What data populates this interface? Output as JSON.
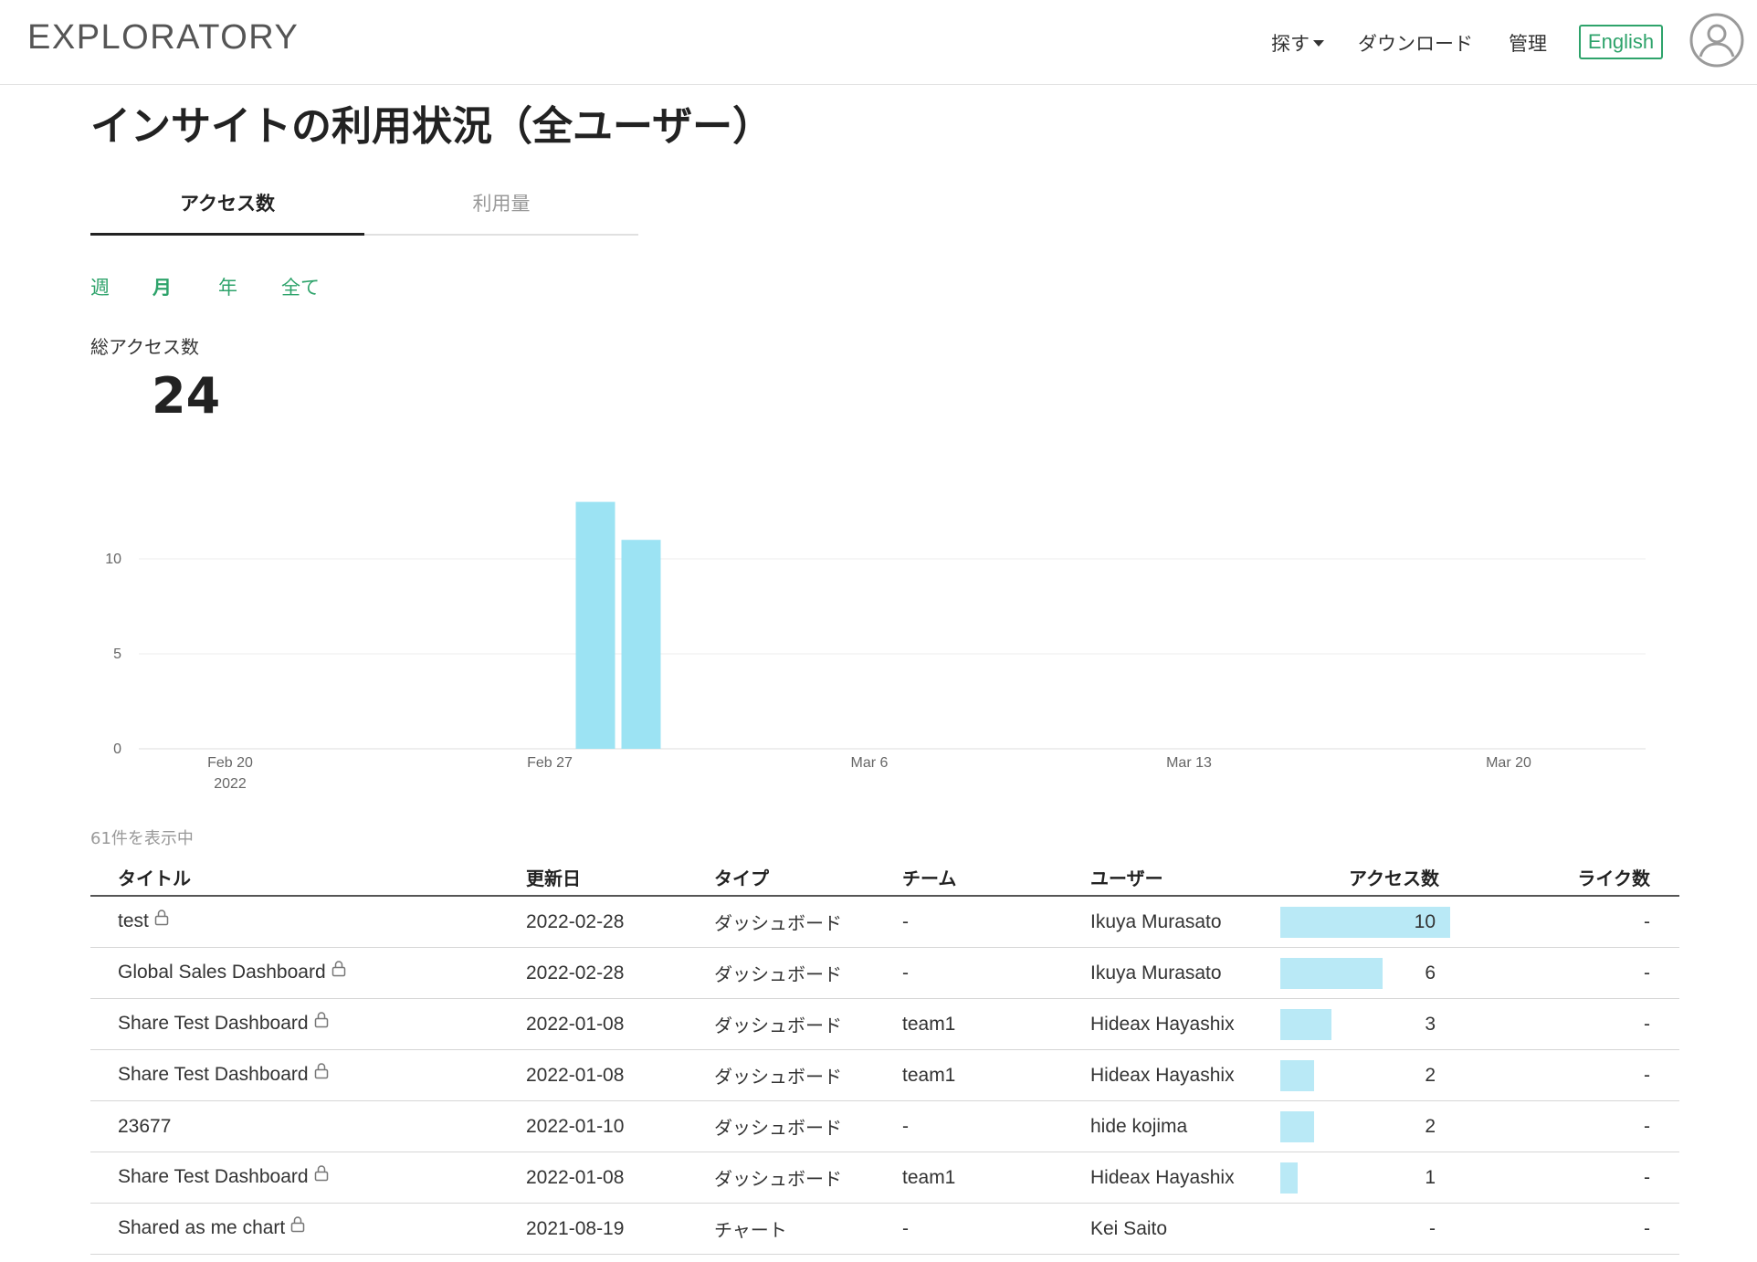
{
  "header": {
    "logo": "EXPLORATORY",
    "nav": [
      {
        "label": "探す",
        "has_dropdown": true
      },
      {
        "label": "ダウンロード"
      },
      {
        "label": "管理"
      }
    ],
    "lang_button": "English"
  },
  "page_title": "インサイトの利用状況（全ユーザー）",
  "tabs": [
    {
      "label": "アクセス数",
      "active": true
    },
    {
      "label": "利用量",
      "active": false
    }
  ],
  "periods": [
    {
      "label": "週",
      "selected": false
    },
    {
      "label": "月",
      "selected": true
    },
    {
      "label": "年",
      "selected": false
    },
    {
      "label": "全て",
      "selected": false
    }
  ],
  "total": {
    "label": "総アクセス数",
    "value": "24"
  },
  "chart_data": {
    "type": "bar",
    "x_type": "date",
    "x": [
      "2022-02-28",
      "2022-03-01"
    ],
    "values": [
      13,
      11
    ],
    "xlim": [
      "2022-02-18",
      "2022-03-23"
    ],
    "ylim": [
      0,
      14
    ],
    "yticks": [
      0,
      5,
      10
    ],
    "xticks": [
      {
        "date": "2022-02-20",
        "label": "Feb 20",
        "sublabel": "2022"
      },
      {
        "date": "2022-02-27",
        "label": "Feb 27"
      },
      {
        "date": "2022-03-06",
        "label": "Mar 6"
      },
      {
        "date": "2022-03-13",
        "label": "Mar 13"
      },
      {
        "date": "2022-03-20",
        "label": "Mar 20"
      }
    ],
    "grid": true,
    "color": "#9ce3f3"
  },
  "table": {
    "count_text": "61件を表示中",
    "columns": [
      "タイトル",
      "更新日",
      "タイプ",
      "チーム",
      "ユーザー",
      "アクセス数",
      "ライク数"
    ],
    "max_access": 10,
    "rows": [
      {
        "title": "test",
        "locked": true,
        "updated": "2022-02-28",
        "type": "ダッシュボード",
        "team": "-",
        "user": "Ikuya Murasato",
        "access": 10,
        "access_label": "10",
        "likes": "-"
      },
      {
        "title": "Global Sales Dashboard",
        "locked": true,
        "updated": "2022-02-28",
        "type": "ダッシュボード",
        "team": "-",
        "user": "Ikuya Murasato",
        "access": 6,
        "access_label": "6",
        "likes": "-"
      },
      {
        "title": "Share Test Dashboard",
        "locked": true,
        "updated": "2022-01-08",
        "type": "ダッシュボード",
        "team": "team1",
        "user": "Hideax Hayashix",
        "access": 3,
        "access_label": "3",
        "likes": "-"
      },
      {
        "title": "Share Test Dashboard",
        "locked": true,
        "updated": "2022-01-08",
        "type": "ダッシュボード",
        "team": "team1",
        "user": "Hideax Hayashix",
        "access": 2,
        "access_label": "2",
        "likes": "-"
      },
      {
        "title": "23677",
        "locked": false,
        "updated": "2022-01-10",
        "type": "ダッシュボード",
        "team": "-",
        "user": "hide kojima",
        "access": 2,
        "access_label": "2",
        "likes": "-"
      },
      {
        "title": "Share Test Dashboard",
        "locked": true,
        "updated": "2022-01-08",
        "type": "ダッシュボード",
        "team": "team1",
        "user": "Hideax Hayashix",
        "access": 1,
        "access_label": "1",
        "likes": "-"
      },
      {
        "title": "Shared as me chart",
        "locked": true,
        "updated": "2021-08-19",
        "type": "チャート",
        "team": "-",
        "user": "Kei Saito",
        "access": 0,
        "access_label": "-",
        "likes": "-"
      }
    ]
  }
}
